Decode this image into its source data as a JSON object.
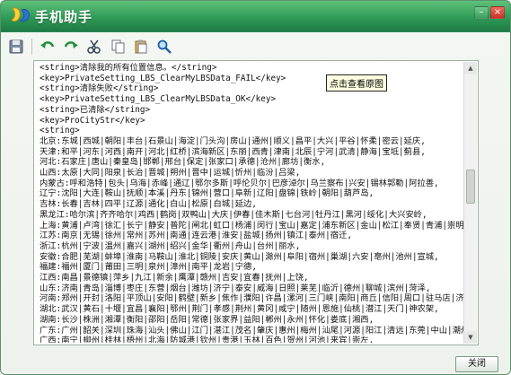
{
  "window": {
    "title": "手机助手"
  },
  "toolbar": {
    "buttons": [
      {
        "name": "save-icon"
      },
      {
        "name": "undo-icon"
      },
      {
        "name": "redo-icon"
      },
      {
        "name": "cut-icon"
      },
      {
        "name": "copy-icon"
      },
      {
        "name": "paste-icon"
      },
      {
        "name": "find-icon"
      }
    ]
  },
  "tooltip": {
    "text": "点击查看原图"
  },
  "document": {
    "lines": [
      "<string>清除我的所有位置信息。</string>",
      "<key>PrivateSetting_LBS_ClearMyLBSData_FAIL</key>",
      "<string>清除失败</string>",
      "<key>PrivateSetting_LBS_ClearMyLBSData_OK</key>",
      "<string>已清除</string>",
      "<key>ProCityStr</key>",
      "<string>",
      "北京:东城|西城|朝阳|丰台|石景山|海淀|门头沟|房山|通州|顺义|昌平|大兴|平谷|怀柔|密云|延庆,",
      "天津:和平|河东|河西|南开|河北|红桥|滨海新区|东丽|西青|津南|北辰|宁河|武清|静海|宝坻|蓟县,",
      "河北:石家庄|唐山|秦皇岛|邯郸|邢台|保定|张家口|承德|沧州|廊坊|衡水,",
      "山西:太原|大同|阳泉|长治|晋城|朔州|晋中|运城|忻州|临汾|吕梁,",
      "内蒙古:呼和浩特|包头|乌海|赤峰|通辽|鄂尔多斯|呼伦贝尔|巴彦淖尔|乌兰察布|兴安|锡林郭勒|阿拉善,",
      "辽宁:沈阳|大连|鞍山|抚顺|本溪|丹东|锦州|营口|阜新|辽阳|盘锦|铁岭|朝阳|葫芦岛,",
      "吉林:长春|吉林|四平|辽源|通化|白山|松原|白城|延边,",
      "黑龙江:哈尔滨|齐齐哈尔|鸡西|鹤岗|双鸭山|大庆|伊春|佳木斯|七台河|牡丹江|黑河|绥化|大兴安岭,",
      "上海:黄浦|卢湾|徐汇|长宁|静安|普陀|闸北|虹口|杨浦|闵行|宝山|嘉定|浦东新区|金山|松江|奉贤|青浦|崇明,",
      "江苏:南京|无锡|徐州|常州|苏州|南通|连云港|淮安|盐城|扬州|镇江|泰州|宿迁,",
      "浙江:杭州|宁波|温州|嘉兴|湖州|绍兴|金华|衢州|舟山|台州|丽水,",
      "安徽:合肥|芜湖|蚌埠|淮南|马鞍山|淮北|铜陵|安庆|黄山|滁州|阜阳|宿州|巢湖|六安|亳州|池州|宣城,",
      "福建:福州|厦门|莆田|三明|泉州|漳州|南平|龙岩|宁德,",
      "江西:南昌|景德镇|萍乡|九江|新余|鹰潭|赣州|吉安|宜春|抚州|上饶,",
      "山东:济南|青岛|淄博|枣庄|东营|烟台|潍坊|济宁|泰安|威海|日照|莱芜|临沂|德州|聊城|滨州|菏泽,",
      "河南:郑州|开封|洛阳|平顶山|安阳|鹤壁|新乡|焦作|濮阳|许昌|漯河|三门峡|南阳|商丘|信阳|周口|驻马店|济源,",
      "湖北:武汉|黄石|十堰|宜昌|襄阳|鄂州|荆门|孝感|荆州|黄冈|咸宁|随州|恩施|仙桃|潜江|天门|神农架,",
      "湖南:长沙|株洲|湘潭|衡阳|邵阳|岳阳|常德|张家界|益阳|郴州|永州|怀化|娄底|湘西,",
      "广东:广州|韶关|深圳|珠海|汕头|佛山|江门|湛江|茂名|肇庆|惠州|梅州|汕尾|河源|阳江|清远|东莞|中山|潮州|揭阳|云浮,",
      "广西:南宁|柳州|桂林|梧州|北海|防城港|钦州|贵港|玉林|百色|贺州|河池|来宾|崇左,"
    ]
  },
  "footer": {
    "close_label": "关闭"
  }
}
